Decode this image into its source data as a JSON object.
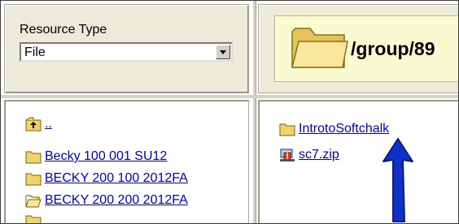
{
  "resource_type": {
    "label": "Resource Type",
    "selected": "File"
  },
  "path": {
    "text": "/group/89"
  },
  "left_list": {
    "items": [
      {
        "label": "..",
        "icon": "folder-up-icon"
      },
      {
        "label": "Becky 100 001 SU12",
        "icon": "folder-icon"
      },
      {
        "label": "BECKY 200 100 2012FA",
        "icon": "folder-icon"
      },
      {
        "label": "BECKY 200 200 2012FA",
        "icon": "folder-open-icon"
      }
    ]
  },
  "right_list": {
    "items": [
      {
        "label": "IntrotoSoftchalk",
        "icon": "folder-icon"
      },
      {
        "label": "sc7.zip",
        "icon": "zip-file-icon"
      }
    ]
  },
  "colors": {
    "link": "#0000cc",
    "panel": "#ecead8",
    "arrow": "#1030c8"
  }
}
